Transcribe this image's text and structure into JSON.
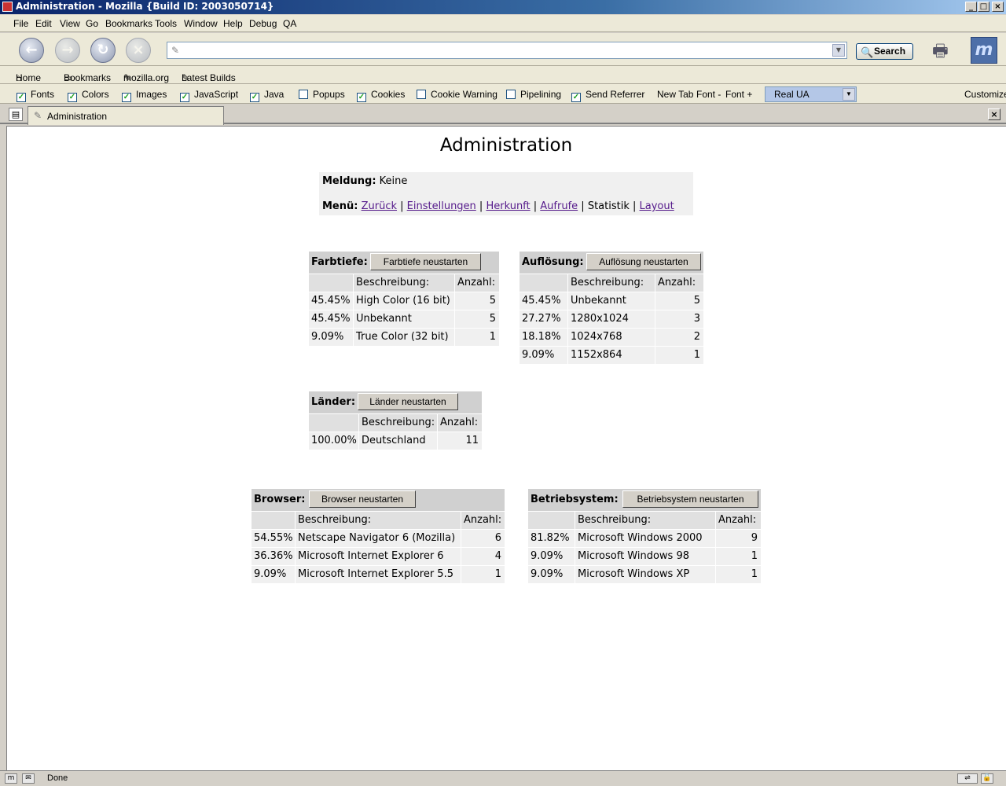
{
  "window": {
    "title": "Administration - Mozilla {Build ID: 2003050714}"
  },
  "menu": [
    "File",
    "Edit",
    "View",
    "Go",
    "Bookmarks",
    "Tools",
    "Window",
    "Help",
    "Debug",
    "QA"
  ],
  "nav": {
    "search_label": "Search",
    "url_value": ""
  },
  "personal": {
    "items": [
      "Home",
      "Bookmarks",
      "mozilla.org",
      "Latest Builds"
    ]
  },
  "prefbar": {
    "checkboxes": [
      {
        "label": "Fonts",
        "checked": true
      },
      {
        "label": "Colors",
        "checked": true
      },
      {
        "label": "Images",
        "checked": true
      },
      {
        "label": "JavaScript",
        "checked": true
      },
      {
        "label": "Java",
        "checked": true
      },
      {
        "label": "Popups",
        "checked": false
      },
      {
        "label": "Cookies",
        "checked": true
      },
      {
        "label": "Cookie Warning",
        "checked": false
      },
      {
        "label": "Pipelining",
        "checked": false
      },
      {
        "label": "Send Referrer",
        "checked": true
      }
    ],
    "new_tab": "New Tab",
    "font_minus": "Font -",
    "font_plus": "Font +",
    "ua_select": "Real UA",
    "customize": "Customize"
  },
  "tab": {
    "label": "Administration"
  },
  "page": {
    "title": "Administration",
    "meldung_label": "Meldung:",
    "meldung_value": "Keine",
    "menu_label": "Menü:",
    "menu_links": [
      "Zurück",
      "Einstellungen",
      "Herkunft",
      "Aufrufe",
      "Statistik",
      "Layout"
    ],
    "tables": {
      "farbtiefe": {
        "title": "Farbtiefe:",
        "button": "Farbtiefe neustarten",
        "col_desc": "Beschreibung:",
        "col_count": "Anzahl:",
        "rows": [
          [
            "45.45%",
            "High Color (16 bit)",
            "5"
          ],
          [
            "45.45%",
            "Unbekannt",
            "5"
          ],
          [
            "9.09%",
            "True Color (32 bit)",
            "1"
          ]
        ]
      },
      "aufloesung": {
        "title": "Auflösung:",
        "button": "Auflösung neustarten",
        "col_desc": "Beschreibung:",
        "col_count": "Anzahl:",
        "rows": [
          [
            "45.45%",
            "Unbekannt",
            "5"
          ],
          [
            "27.27%",
            "1280x1024",
            "3"
          ],
          [
            "18.18%",
            "1024x768",
            "2"
          ],
          [
            "9.09%",
            "1152x864",
            "1"
          ]
        ]
      },
      "laender": {
        "title": "Länder:",
        "button": "Länder neustarten",
        "col_desc": "Beschreibung:",
        "col_count": "Anzahl:",
        "rows": [
          [
            "100.00%",
            "Deutschland",
            "11"
          ]
        ]
      },
      "browser": {
        "title": "Browser:",
        "button": "Browser neustarten",
        "col_desc": "Beschreibung:",
        "col_count": "Anzahl:",
        "rows": [
          [
            "54.55%",
            "Netscape Navigator 6 (Mozilla)",
            "6"
          ],
          [
            "36.36%",
            "Microsoft Internet Explorer 6",
            "4"
          ],
          [
            "9.09%",
            "Microsoft Internet Explorer 5.5",
            "1"
          ]
        ]
      },
      "betriebssystem": {
        "title": "Betriebsystem:",
        "button": "Betriebsystem neustarten",
        "col_desc": "Beschreibung:",
        "col_count": "Anzahl:",
        "rows": [
          [
            "81.82%",
            "Microsoft Windows 2000",
            "9"
          ],
          [
            "9.09%",
            "Microsoft Windows 98",
            "1"
          ],
          [
            "9.09%",
            "Microsoft Windows XP",
            "1"
          ]
        ]
      }
    }
  },
  "status": {
    "text": "Done"
  }
}
